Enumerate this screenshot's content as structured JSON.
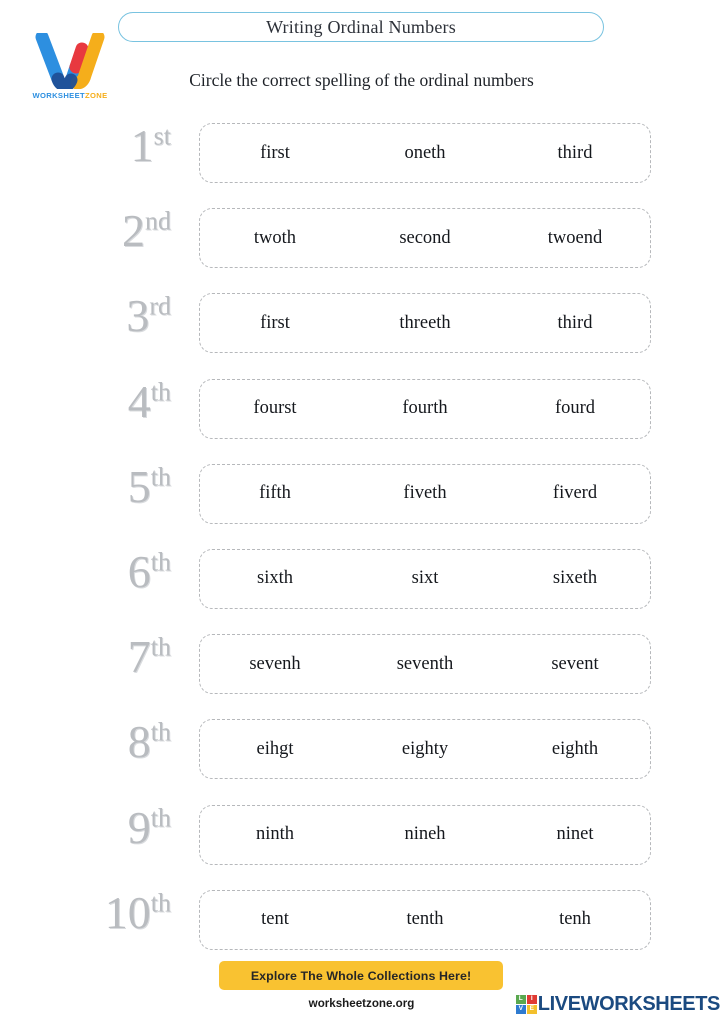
{
  "header": {
    "title": "Writing Ordinal Numbers",
    "instruction": "Circle the correct spelling of the ordinal numbers",
    "logo": {
      "name_part1": "WORKSHEET",
      "name_part2": "ZONE",
      "colors": {
        "blue": "#2d8fe0",
        "red": "#e8393f",
        "yellow": "#f5ae1b"
      }
    },
    "title_border_color": "#79c3e0"
  },
  "rows": [
    {
      "number": "1",
      "suffix": "st",
      "choices": [
        "first",
        "oneth",
        "third"
      ]
    },
    {
      "number": "2",
      "suffix": "nd",
      "choices": [
        "twoth",
        "second",
        "twoend"
      ]
    },
    {
      "number": "3",
      "suffix": "rd",
      "choices": [
        "first",
        "threeth",
        "third"
      ]
    },
    {
      "number": "4",
      "suffix": "th",
      "choices": [
        "fourst",
        "fourth",
        "fourd"
      ]
    },
    {
      "number": "5",
      "suffix": "th",
      "choices": [
        "fifth",
        "fiveth",
        "fiverd"
      ]
    },
    {
      "number": "6",
      "suffix": "th",
      "choices": [
        "sixth",
        "sixt",
        "sixeth"
      ]
    },
    {
      "number": "7",
      "suffix": "th",
      "choices": [
        "sevenh",
        "seventh",
        "sevent"
      ]
    },
    {
      "number": "8",
      "suffix": "th",
      "choices": [
        "eihgt",
        "eighty",
        "eighth"
      ]
    },
    {
      "number": "9",
      "suffix": "th",
      "choices": [
        "ninth",
        "nineh",
        "ninet"
      ]
    },
    {
      "number": "10",
      "suffix": "th",
      "choices": [
        "tent",
        "tenth",
        "tenh"
      ]
    }
  ],
  "footer": {
    "cta_label": "Explore The Whole Collections Here!",
    "cta_color": "#f9c231",
    "site_url": "worksheetzone.org",
    "brand": {
      "tiles": [
        "L",
        "I",
        "V",
        "E"
      ],
      "text": "LIVEWORKSHEETS",
      "text_color": "#1b4a80"
    }
  }
}
